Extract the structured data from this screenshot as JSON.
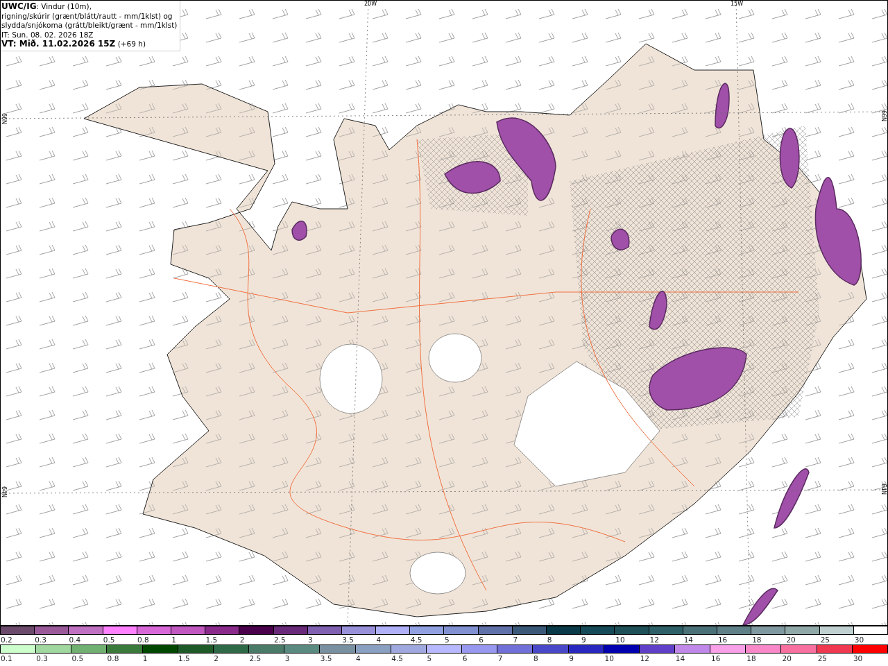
{
  "header": {
    "lines": [
      "**UWC/IG**: Vindur (10m),",
      "rigning/skúrir (grænt/blátt/rautt - mm/1klst) og",
      "slydda/snjókoma (grátt/bleikt/grænt - mm/1klst)",
      "IT: Sun. 08. 02. 2026 18Z",
      "**VT: Mið. 11.02.2026 15Z** (+69 h)"
    ]
  },
  "map_labels": {
    "top": [
      "20W",
      "15W"
    ],
    "left": [
      "66N",
      "64N"
    ],
    "right": [
      "66N",
      "64N"
    ]
  },
  "legend_rows": [
    [
      {
        "label": "0.2",
        "color": "#6b4a6b"
      },
      {
        "label": "0.3",
        "color": "#9a5a9a"
      },
      {
        "label": "0.4",
        "color": "#c070c0"
      },
      {
        "label": "0.5",
        "color": "#ff80ff"
      },
      {
        "label": "0.8",
        "color": "#d868d8"
      },
      {
        "label": "1",
        "color": "#c058c0"
      },
      {
        "label": "1.5",
        "color": "#8a2a8a"
      },
      {
        "label": "2",
        "color": "#4a004a"
      },
      {
        "label": "2.5",
        "color": "#6a2a7a"
      },
      {
        "label": "3",
        "color": "#8060b0"
      },
      {
        "label": "3.5",
        "color": "#9890d8"
      },
      {
        "label": "4",
        "color": "#b0b0f8"
      },
      {
        "label": "4.5",
        "color": "#90a0e0"
      },
      {
        "label": "5",
        "color": "#8090d0"
      },
      {
        "label": "6",
        "color": "#6070a8"
      },
      {
        "label": "7",
        "color": "#3a5878"
      },
      {
        "label": "8",
        "color": "#0a3a48"
      },
      {
        "label": "9",
        "color": "#164a58"
      },
      {
        "label": "10",
        "color": "#1e5058"
      },
      {
        "label": "12",
        "color": "#2e6068"
      },
      {
        "label": "14",
        "color": "#4a7078"
      },
      {
        "label": "16",
        "color": "#608088"
      },
      {
        "label": "18",
        "color": "#8098a0"
      },
      {
        "label": "20",
        "color": "#90a8a8"
      },
      {
        "label": "25",
        "color": "#c0d0d0"
      },
      {
        "label": "30",
        "color": "#ffffff"
      }
    ],
    [
      {
        "label": "0.1",
        "color": "#ccffcc"
      },
      {
        "label": "0.3",
        "color": "#a0d8a0"
      },
      {
        "label": "0.5",
        "color": "#70b070"
      },
      {
        "label": "0.8",
        "color": "#3a7a3a"
      },
      {
        "label": "1",
        "color": "#004800"
      },
      {
        "label": "1.5",
        "color": "#1e5a28"
      },
      {
        "label": "2",
        "color": "#2e6a48"
      },
      {
        "label": "2.5",
        "color": "#4a7a68"
      },
      {
        "label": "3",
        "color": "#5a8a80"
      },
      {
        "label": "3.5",
        "color": "#7890a0"
      },
      {
        "label": "4",
        "color": "#8aa0c0"
      },
      {
        "label": "4.5",
        "color": "#a0a8e0"
      },
      {
        "label": "5",
        "color": "#b8b8ff"
      },
      {
        "label": "6",
        "color": "#9898f0"
      },
      {
        "label": "7",
        "color": "#7070d8"
      },
      {
        "label": "8",
        "color": "#4848c8"
      },
      {
        "label": "9",
        "color": "#2828c0"
      },
      {
        "label": "10",
        "color": "#0000b0"
      },
      {
        "label": "12",
        "color": "#6040c8"
      },
      {
        "label": "14",
        "color": "#c088e8"
      },
      {
        "label": "16",
        "color": "#f8a0e8"
      },
      {
        "label": "18",
        "color": "#f888c8"
      },
      {
        "label": "20",
        "color": "#f870a0"
      },
      {
        "label": "25",
        "color": "#f03850"
      },
      {
        "label": "30",
        "color": "#ff0000"
      }
    ]
  ]
}
